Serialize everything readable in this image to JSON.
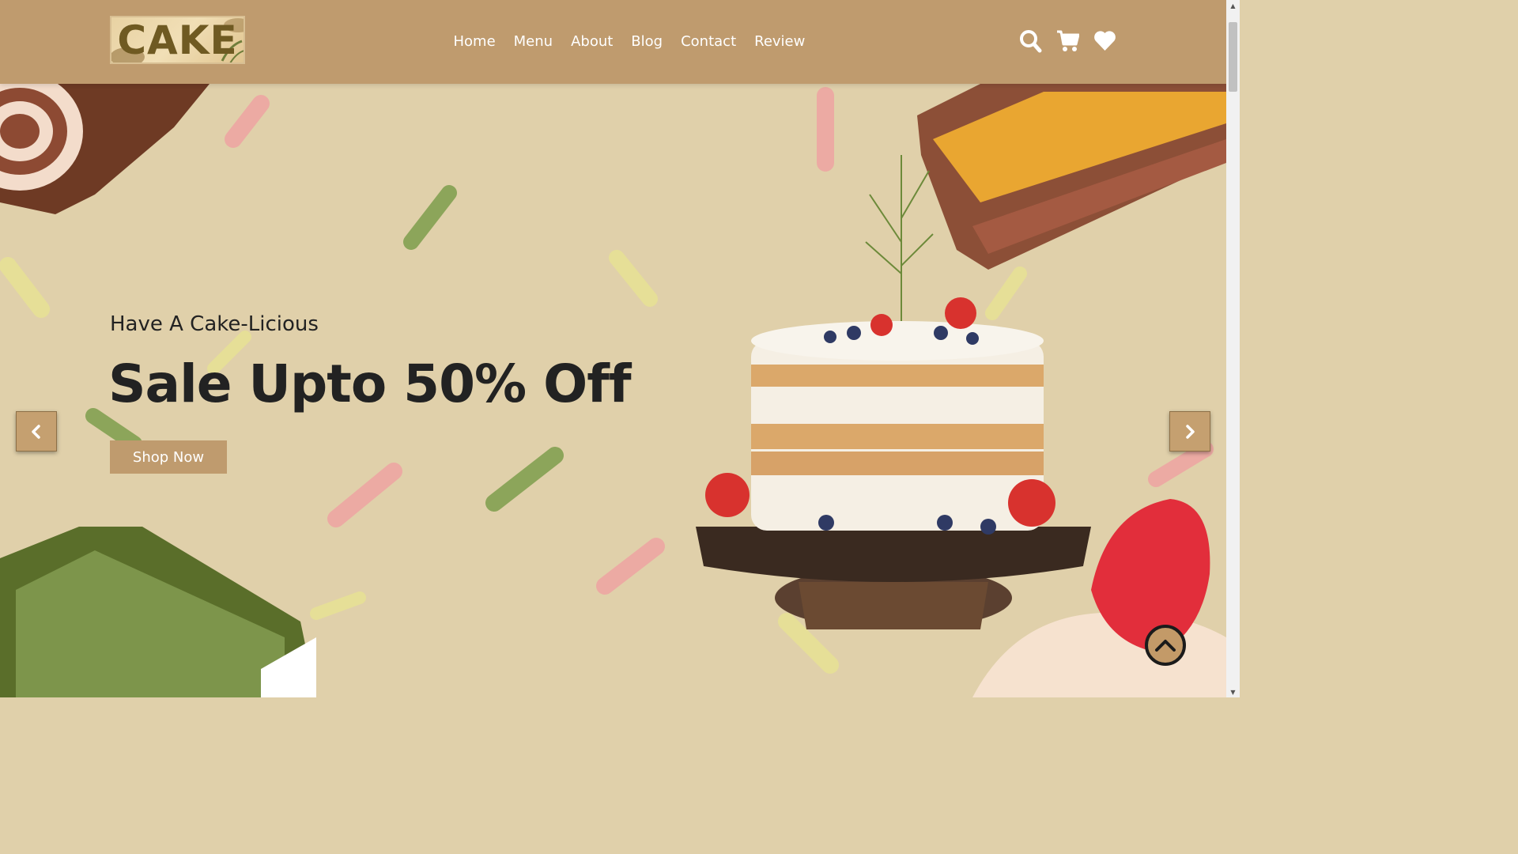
{
  "header": {
    "logo_text": "CAKE",
    "nav": [
      "Home",
      "Menu",
      "About",
      "Blog",
      "Contact",
      "Review"
    ],
    "icons": [
      "search-icon",
      "cart-icon",
      "heart-icon"
    ]
  },
  "hero": {
    "subtitle": "Have A Cake-Licious",
    "headline": "Sale Upto 50% Off",
    "cta": "Shop Now"
  },
  "colors": {
    "header_bg": "#bf9b6e",
    "hero_bg": "#e0d0aa",
    "accent": "#bf9b6e",
    "text": "#222222"
  }
}
